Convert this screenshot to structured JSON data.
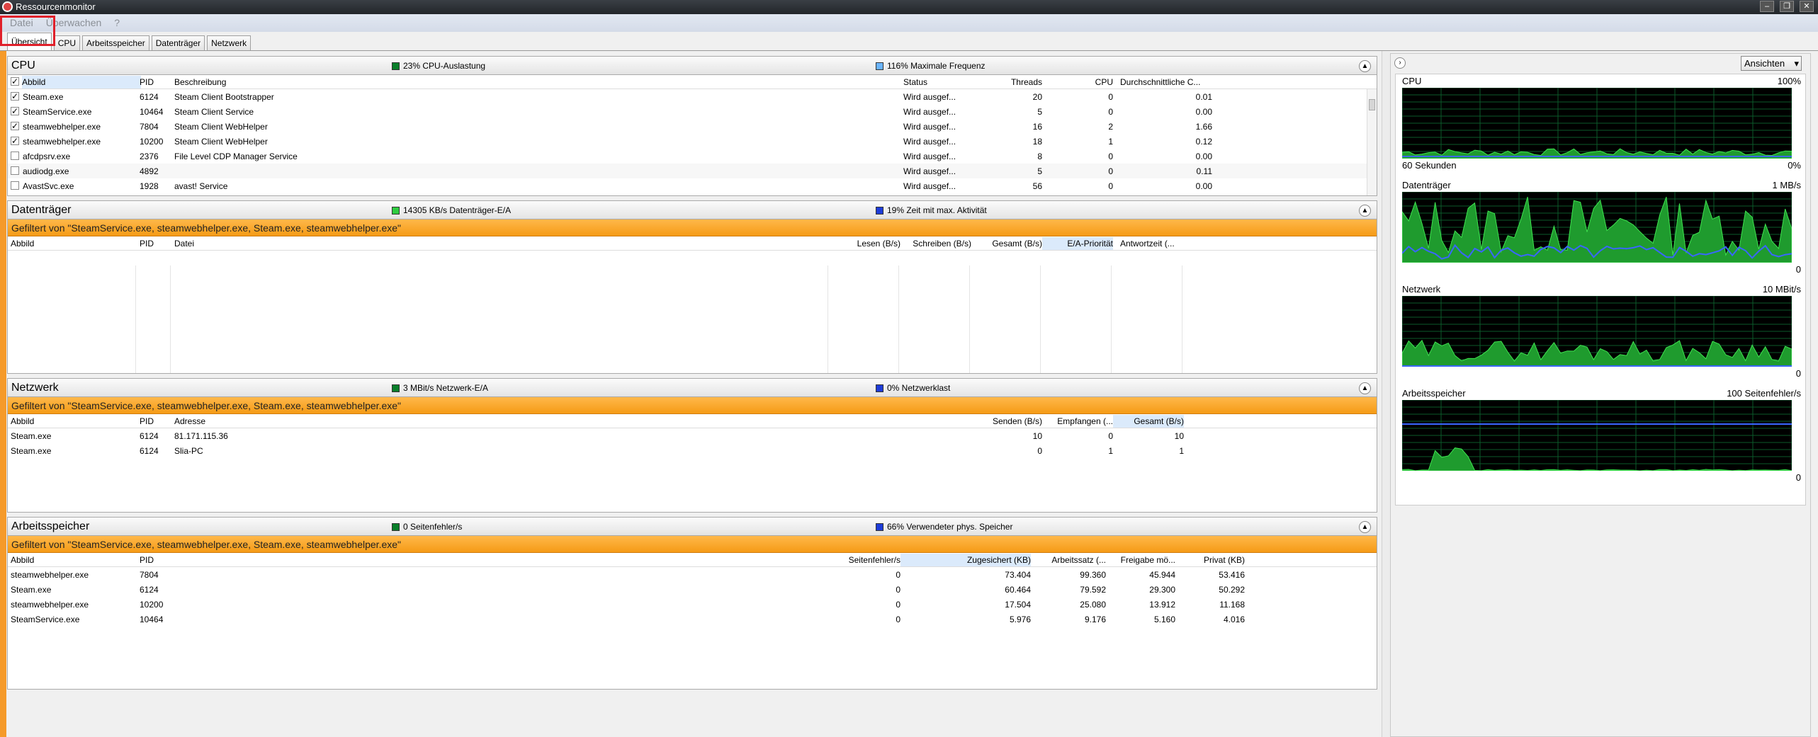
{
  "window": {
    "title": "Ressourcenmonitor"
  },
  "menu": [
    "Datei",
    "Überwachen",
    "?"
  ],
  "tabs": [
    "Übersicht",
    "CPU",
    "Arbeitsspeicher",
    "Datenträger",
    "Netzwerk"
  ],
  "colors": {
    "orange": "#f59b16",
    "cpu_green": "#0a7f2a",
    "disk_green": "#2ecc40",
    "mem_blue": "#1e3cd8",
    "graph_bg": "#000000"
  },
  "cpu": {
    "title": "CPU",
    "ind1": "23% CPU-Auslastung",
    "ind2": "116% Maximale Frequenz",
    "cols": [
      "Abbild",
      "PID",
      "Beschreibung",
      "Status",
      "Threads",
      "CPU",
      "Durchschnittliche C..."
    ],
    "rows": [
      {
        "name": "Steam.exe",
        "pid": "6124",
        "desc": "Steam Client Bootstrapper",
        "status": "Wird ausgef...",
        "threads": "20",
        "cpu": "0",
        "avg": "0.01",
        "checked": true
      },
      {
        "name": "SteamService.exe",
        "pid": "10464",
        "desc": "Steam Client Service",
        "status": "Wird ausgef...",
        "threads": "5",
        "cpu": "0",
        "avg": "0.00",
        "checked": true
      },
      {
        "name": "steamwebhelper.exe",
        "pid": "7804",
        "desc": "Steam Client WebHelper",
        "status": "Wird ausgef...",
        "threads": "16",
        "cpu": "2",
        "avg": "1.66",
        "checked": true
      },
      {
        "name": "steamwebhelper.exe",
        "pid": "10200",
        "desc": "Steam Client WebHelper",
        "status": "Wird ausgef...",
        "threads": "18",
        "cpu": "1",
        "avg": "0.12",
        "checked": true
      },
      {
        "name": "afcdpsrv.exe",
        "pid": "2376",
        "desc": "File Level CDP Manager Service",
        "status": "Wird ausgef...",
        "threads": "8",
        "cpu": "0",
        "avg": "0.00",
        "checked": false
      },
      {
        "name": "audiodg.exe",
        "pid": "4892",
        "desc": "",
        "status": "Wird ausgef...",
        "threads": "5",
        "cpu": "0",
        "avg": "0.11",
        "checked": false
      },
      {
        "name": "AvastSvc.exe",
        "pid": "1928",
        "desc": "avast! Service",
        "status": "Wird ausgef...",
        "threads": "56",
        "cpu": "0",
        "avg": "0.00",
        "checked": false
      }
    ]
  },
  "disk": {
    "title": "Datenträger",
    "ind1": "14305 KB/s Datenträger-E/A",
    "ind2": "19% Zeit mit max. Aktivität",
    "filter": "Gefiltert von \"SteamService.exe, steamwebhelper.exe, Steam.exe, steamwebhelper.exe\"",
    "cols": [
      "Abbild",
      "PID",
      "Datei",
      "Lesen (B/s)",
      "Schreiben (B/s)",
      "Gesamt (B/s)",
      "E/A-Priorität",
      "Antwortzeit (..."
    ]
  },
  "net": {
    "title": "Netzwerk",
    "ind1": "3 MBit/s Netzwerk-E/A",
    "ind2": "0% Netzwerklast",
    "filter": "Gefiltert von \"SteamService.exe, steamwebhelper.exe, Steam.exe, steamwebhelper.exe\"",
    "cols": [
      "Abbild",
      "PID",
      "Adresse",
      "Senden (B/s)",
      "Empfangen (...",
      "Gesamt (B/s)"
    ],
    "rows": [
      {
        "name": "Steam.exe",
        "pid": "6124",
        "addr": "81.171.115.36",
        "send": "10",
        "recv": "0",
        "total": "10"
      },
      {
        "name": "Steam.exe",
        "pid": "6124",
        "addr": "Slia-PC",
        "send": "0",
        "recv": "1",
        "total": "1"
      }
    ]
  },
  "mem": {
    "title": "Arbeitsspeicher",
    "ind1": "0 Seitenfehler/s",
    "ind2": "66% Verwendeter phys. Speicher",
    "filter": "Gefiltert von \"SteamService.exe, steamwebhelper.exe, Steam.exe, steamwebhelper.exe\"",
    "cols": [
      "Abbild",
      "PID",
      "Seitenfehler/s",
      "Zugesichert (KB)",
      "Arbeitssatz (...",
      "Freigabe mö...",
      "Privat (KB)"
    ],
    "rows": [
      {
        "name": "steamwebhelper.exe",
        "pid": "7804",
        "pf": "0",
        "commit": "73.404",
        "ws": "99.360",
        "share": "45.944",
        "priv": "53.416"
      },
      {
        "name": "Steam.exe",
        "pid": "6124",
        "pf": "0",
        "commit": "60.464",
        "ws": "79.592",
        "share": "29.300",
        "priv": "50.292"
      },
      {
        "name": "steamwebhelper.exe",
        "pid": "10200",
        "pf": "0",
        "commit": "17.504",
        "ws": "25.080",
        "share": "13.912",
        "priv": "11.168"
      },
      {
        "name": "SteamService.exe",
        "pid": "10464",
        "pf": "0",
        "commit": "5.976",
        "ws": "9.176",
        "share": "5.160",
        "priv": "4.016"
      }
    ]
  },
  "right": {
    "views_label": "Ansichten",
    "graphs": [
      {
        "title": "CPU",
        "top": "100%",
        "bl": "60 Sekunden",
        "br": "0%"
      },
      {
        "title": "Datenträger",
        "top": "1 MB/s",
        "bl": "",
        "br": "0"
      },
      {
        "title": "Netzwerk",
        "top": "10 MBit/s",
        "bl": "",
        "br": "0"
      },
      {
        "title": "Arbeitsspeicher",
        "top": "100 Seitenfehler/s",
        "bl": "",
        "br": "0"
      }
    ]
  }
}
